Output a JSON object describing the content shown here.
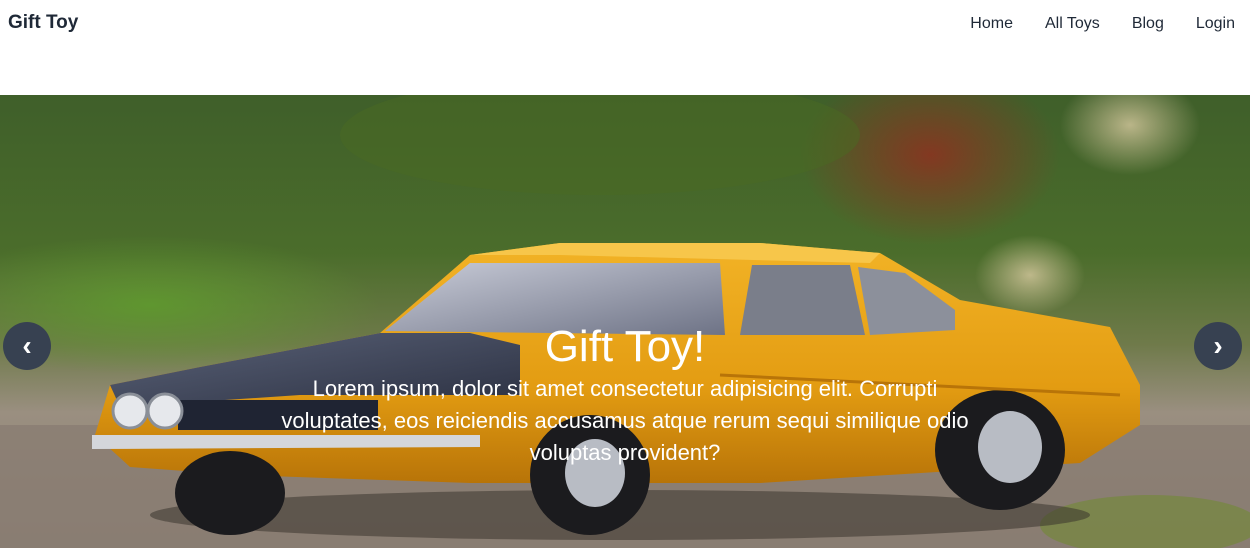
{
  "navbar": {
    "brand": "Gift Toy",
    "links": [
      {
        "label": "Home"
      },
      {
        "label": "All Toys"
      },
      {
        "label": "Blog"
      },
      {
        "label": "Login"
      }
    ]
  },
  "hero": {
    "title": "Gift Toy!",
    "text": "Lorem ipsum, dolor sit amet consectetur adipisicing elit. Corrupti voluptates, eos reiciendis accusamus atque rerum sequi similique odio voluptas provident?",
    "prev_icon": "chevron-left-icon",
    "next_icon": "chevron-right-icon",
    "prev_glyph": "‹",
    "next_glyph": "›"
  },
  "colors": {
    "car_body": "#e9a317",
    "car_hood": "#3b4256",
    "carousel_button": "#374151"
  }
}
